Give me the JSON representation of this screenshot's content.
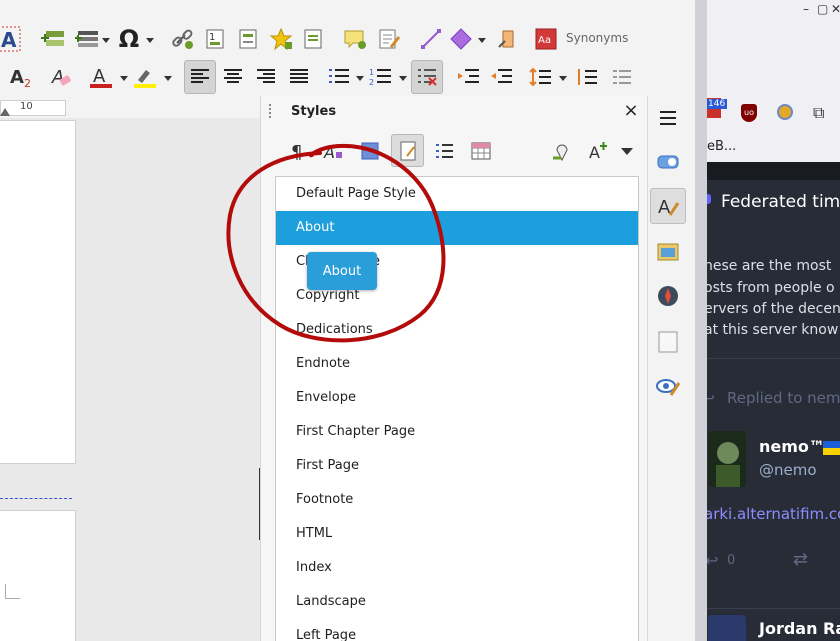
{
  "writer": {
    "toolbar1": {
      "synonyms_label": "Synonyms"
    },
    "ruler": {
      "mark": "10"
    },
    "styles_panel": {
      "title": "Styles",
      "close_glyph": "×",
      "items": [
        "Default Page Style",
        "About",
        "Chapter Title",
        "Copyright",
        "Dedications",
        "Endnote",
        "Envelope",
        "First Chapter Page",
        "First Page",
        "Footnote",
        "HTML",
        "Index",
        "Landscape",
        "Left Page"
      ],
      "selected_item": "About",
      "drag_ghost_label": "About"
    },
    "sidebar_tabs": [
      "menu-icon",
      "properties-icon",
      "styles-icon",
      "gallery-icon",
      "navigator-icon",
      "page-icon",
      "style-inspector-icon"
    ]
  },
  "browser": {
    "extension_badge": "146",
    "bookmark_text": "eB...",
    "window_controls": [
      "–",
      "▢",
      "✕"
    ],
    "feed": {
      "title": "Federated tim",
      "description_lines": [
        "hese are the most",
        "osts from people o",
        "ervers of the decen",
        "at this server know"
      ],
      "replied_to": "Replied to nem",
      "post_author": "nemo™",
      "post_handle": "@nemo",
      "post_link": "arki.alternatifim.co",
      "reply_count": "0",
      "next_author": "Jordan Ra"
    }
  },
  "annotation": {
    "color": "#b00000"
  }
}
